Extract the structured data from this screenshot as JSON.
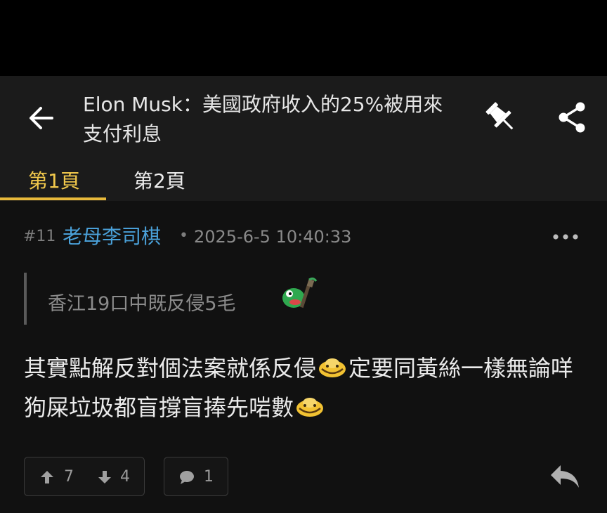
{
  "header": {
    "title": "Elon Musk：美國政府收入的25%被用來支付利息",
    "back_icon": "arrow-left-icon",
    "pin_icon": "pin-icon",
    "share_icon": "share-icon"
  },
  "tabs": [
    {
      "label": "第1頁",
      "active": true
    },
    {
      "label": "第2頁",
      "active": false
    }
  ],
  "post": {
    "floor": "#11",
    "author": "老母李司棋",
    "separator": "•",
    "timestamp": "2025-6-5 10:40:33",
    "quote": "香江19口中既反侵5毛",
    "body_part1": "其實點解反對個法案就係反侵",
    "body_part2": "定要同黃絲一樣無論咩狗屎垃圾都盲撐盲捧先啱數",
    "upvotes": "7",
    "downvotes": "4",
    "comments": "1"
  },
  "colors": {
    "accent": "#f2c94c",
    "author": "#4aa0d8",
    "background": "#111111",
    "header": "#1b1b1b"
  }
}
